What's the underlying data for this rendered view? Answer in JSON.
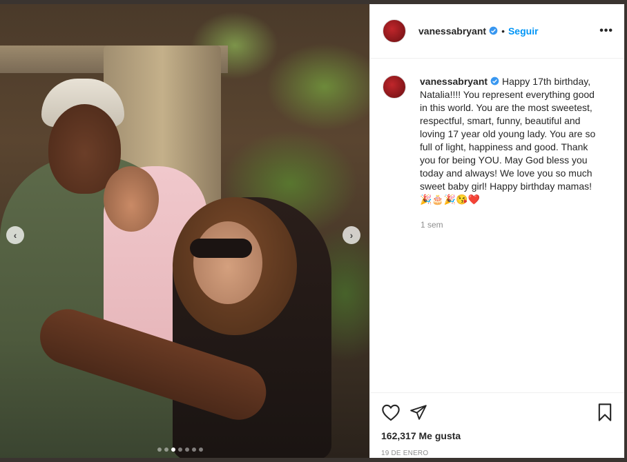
{
  "post": {
    "username": "vanessabryant",
    "separator": "•",
    "follow_label": "Seguir",
    "more_label": "•••",
    "caption_text": "Happy 17th birthday, Natalia!!!! You represent everything good in this world. You are the most sweetest, respectful, smart, funny, beautiful and loving 17 year old young lady. You are so full of light, happiness and good. Thank you for being YOU. May God bless you today and always! We love you so much sweet baby girl! Happy birthday mamas!",
    "caption_emojis": "🎉🎂🎉😘❤️",
    "time_ago": "1 sem",
    "likes": "162,317 Me gusta",
    "date": "19 DE ENERO"
  },
  "carousel": {
    "prev_label": "‹",
    "next_label": "›",
    "slide_count": 7,
    "active_slide": 3
  },
  "colors": {
    "accent": "#0095f6",
    "text": "#262626",
    "muted": "#8e8e8e",
    "heart_emoji": "#e0245e"
  },
  "icons": [
    "verified-badge-icon",
    "more-options-icon",
    "heart-icon",
    "send-icon",
    "bookmark-icon",
    "chevron-left-icon",
    "chevron-right-icon"
  ]
}
